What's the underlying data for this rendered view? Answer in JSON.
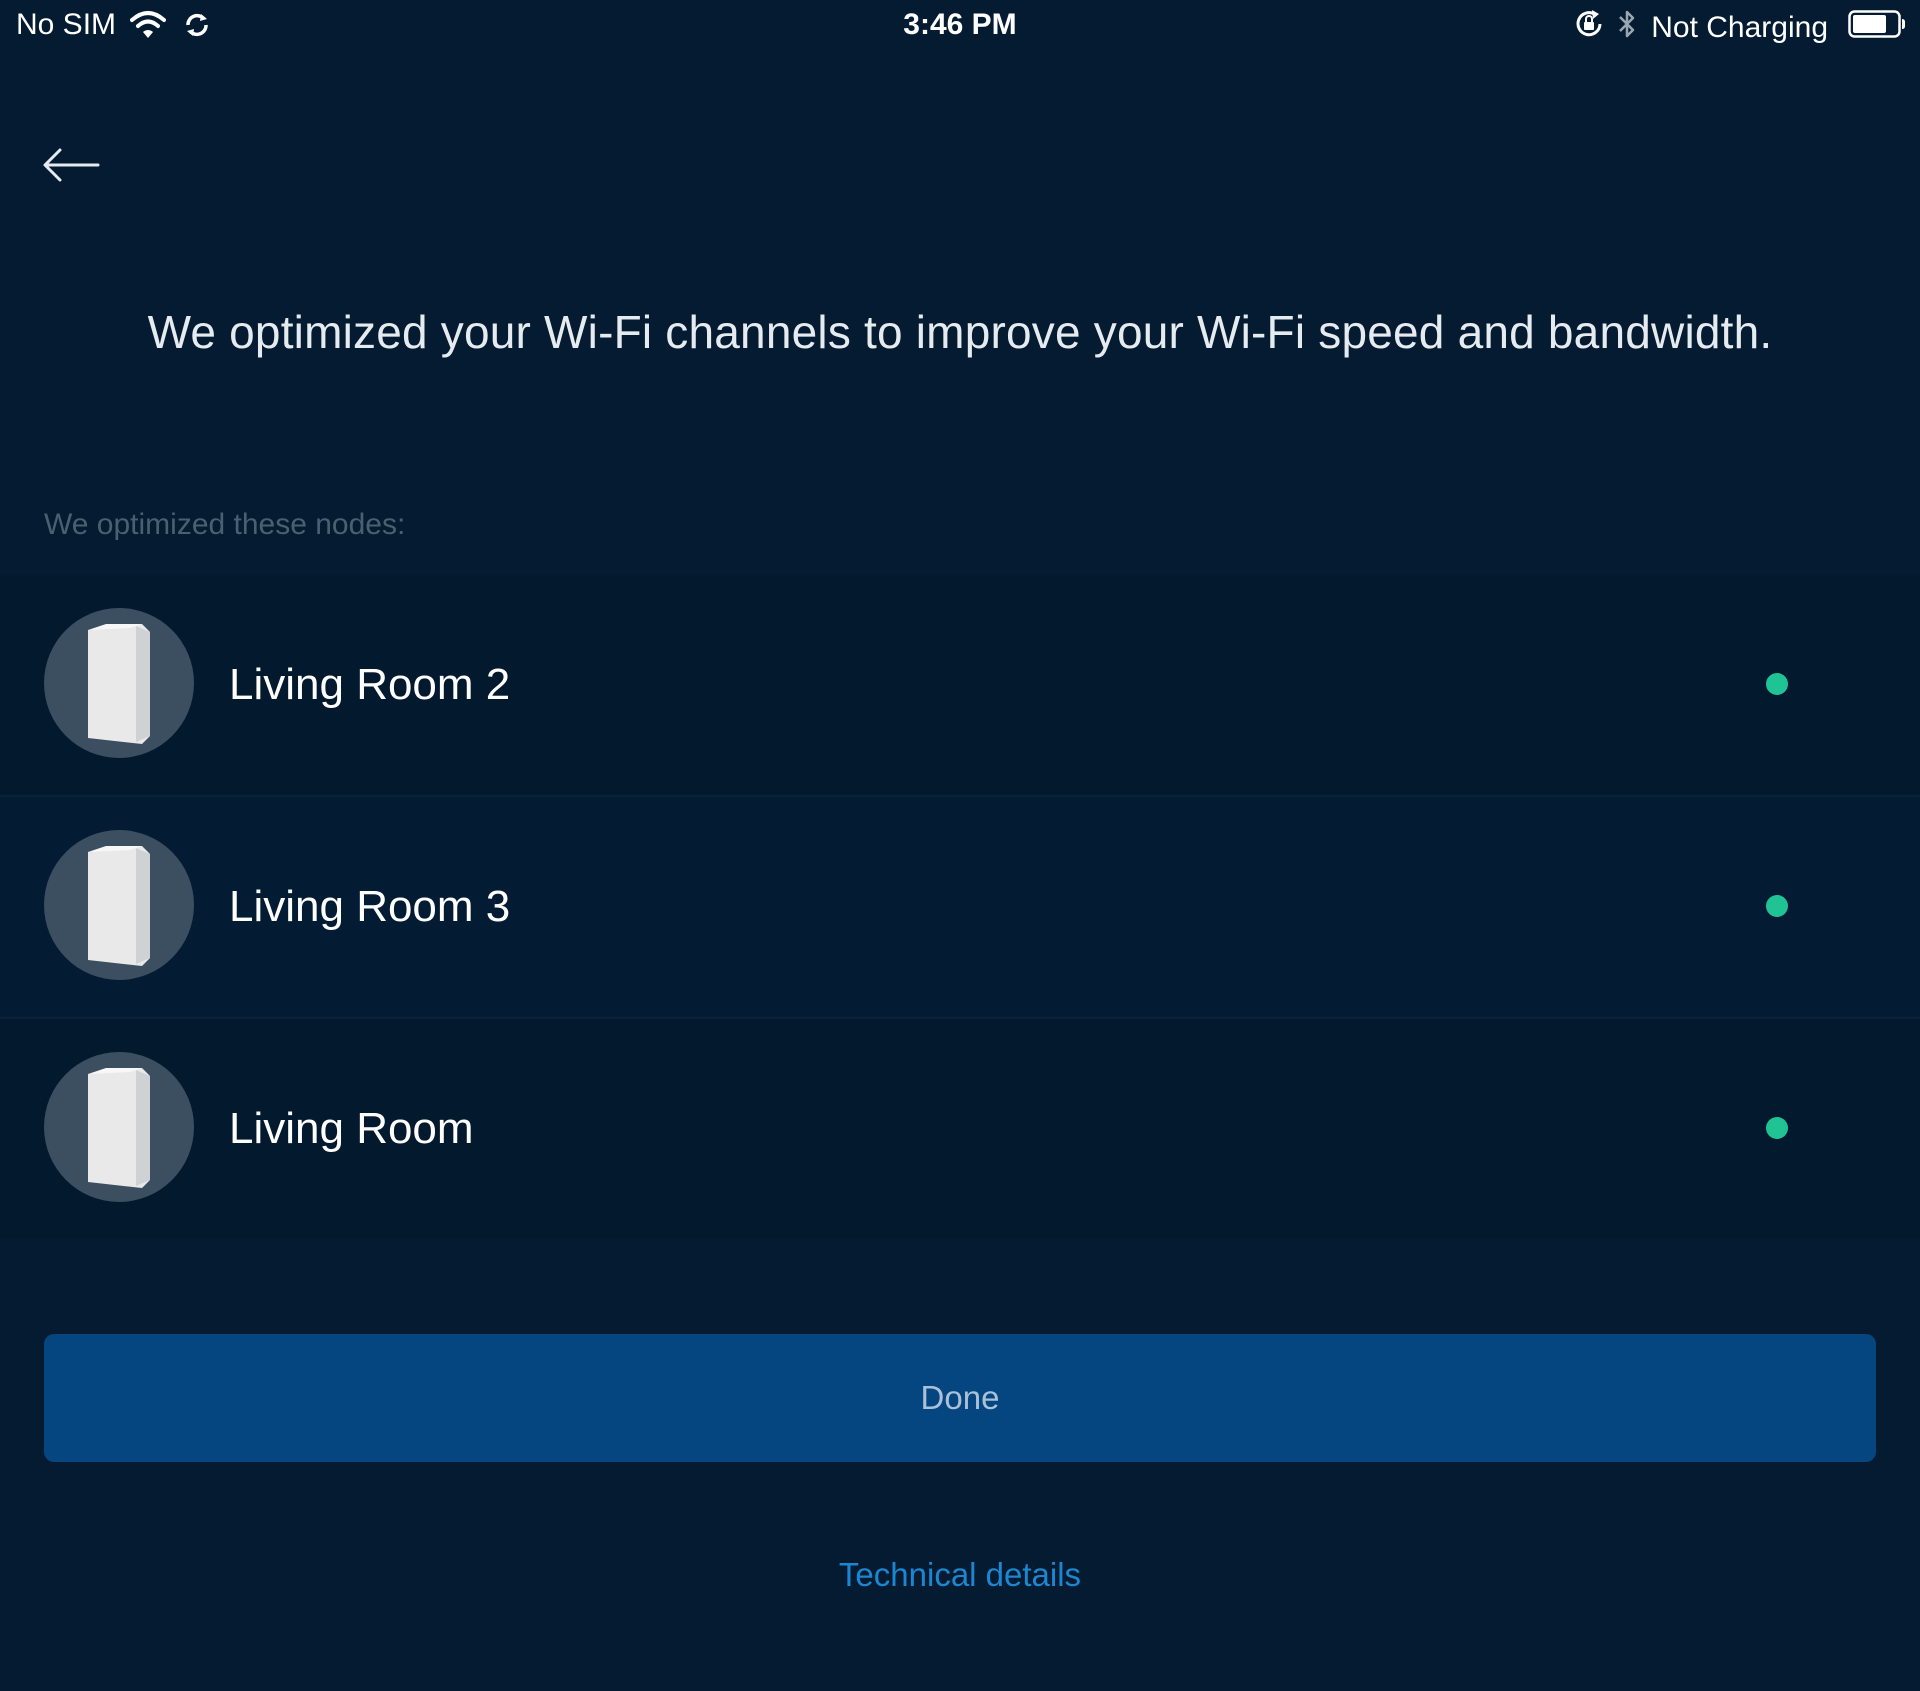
{
  "status_bar": {
    "carrier": "No SIM",
    "time": "3:46 PM",
    "charging": "Not Charging",
    "battery_level": 0.75
  },
  "page": {
    "headline": "We optimized your Wi-Fi channels to improve your Wi-Fi speed and bandwidth.",
    "nodes_caption": "We optimized these nodes:"
  },
  "nodes": [
    {
      "name": "Living Room 2",
      "status": "online"
    },
    {
      "name": "Living Room 3",
      "status": "online"
    },
    {
      "name": "Living Room",
      "status": "online"
    }
  ],
  "actions": {
    "done_label": "Done",
    "technical_details_label": "Technical details"
  },
  "colors": {
    "background": "#041b31",
    "button": "#054680",
    "link": "#1b86d1",
    "status_online": "#1fc394"
  },
  "icons": {
    "back": "arrow-left-icon",
    "wifi": "wifi-icon",
    "sync": "sync-icon",
    "rotation_lock": "rotation-lock-icon",
    "bluetooth": "bluetooth-icon",
    "battery": "battery-icon",
    "node": "router-node-icon"
  }
}
